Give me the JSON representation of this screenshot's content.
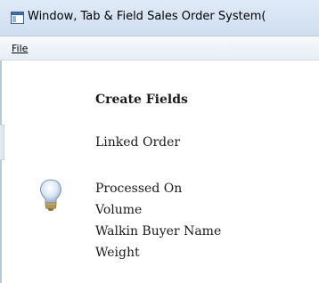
{
  "window": {
    "title": "Window, Tab & Field  Sales Order System("
  },
  "menu": {
    "file_label": "File"
  },
  "content": {
    "heading": "Create Fields",
    "linked_label": "Linked Order",
    "fields": [
      "Processed On",
      "Volume",
      "Walkin Buyer Name",
      "Weight"
    ]
  },
  "icons": {
    "app": "window-app-icon",
    "hint": "lightbulb-icon"
  },
  "colors": {
    "titlebar": "#cfdeef",
    "menubar": "#e7edf5",
    "text": "#1a1a1a"
  }
}
